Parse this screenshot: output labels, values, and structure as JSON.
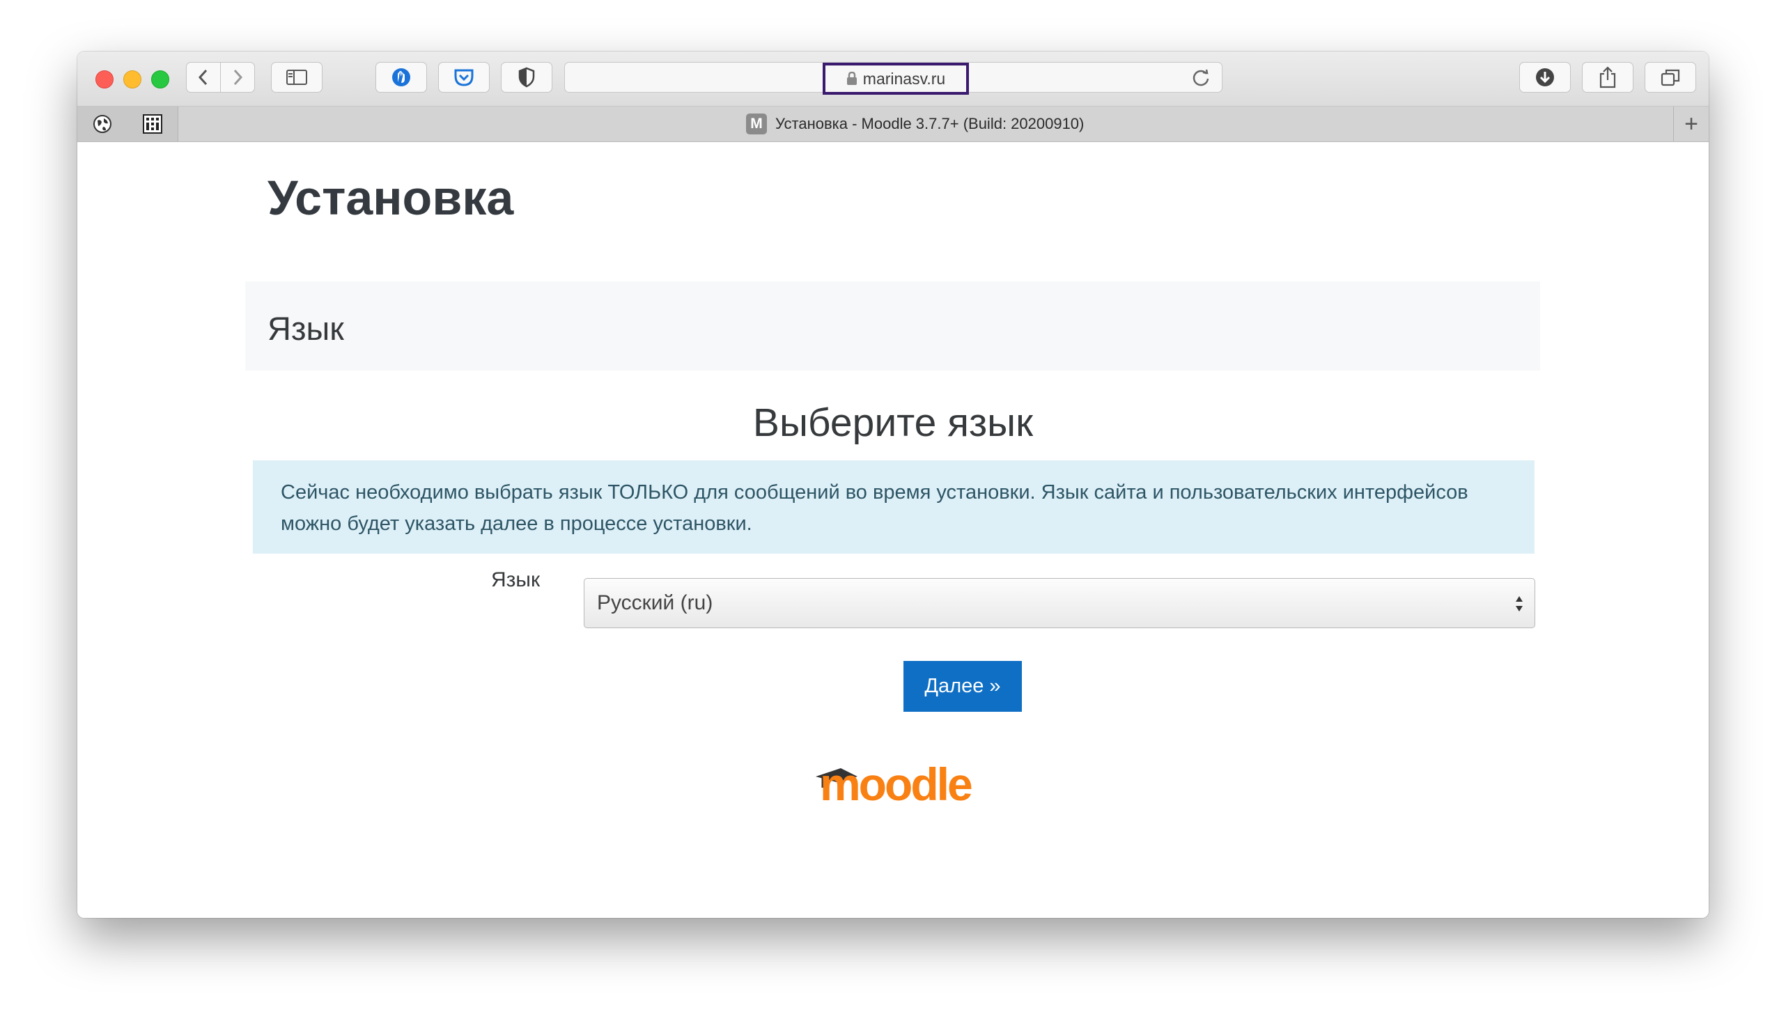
{
  "browser": {
    "url": "marinasv.ru",
    "tab_title": "Установка - Moodle 3.7.7+ (Build: 20200910)",
    "favicon_letter": "M",
    "new_tab_symbol": "+"
  },
  "page": {
    "title": "Установка",
    "section_heading": "Язык",
    "choose_heading": "Выберите язык",
    "info_text": "Сейчас необходимо выбрать язык ТОЛЬКО для сообщений во время установки. Язык сайта и пользовательских интерфейсов можно будет указать далее в процессе установки.",
    "language_label": "Язык",
    "language_value": "Русский (ru)",
    "next_button": "Далее »",
    "logo_text": "moodle"
  },
  "colors": {
    "accent": "#0f6fc5",
    "logo_orange": "#f98012",
    "info_bg": "#def0f7"
  },
  "icons": [
    "back-icon",
    "forward-icon",
    "sidebar-icon",
    "privacy-icon",
    "pocket-icon",
    "shield-icon",
    "lock-icon",
    "reload-icon",
    "download-icon",
    "share-icon",
    "tabs-icon"
  ]
}
